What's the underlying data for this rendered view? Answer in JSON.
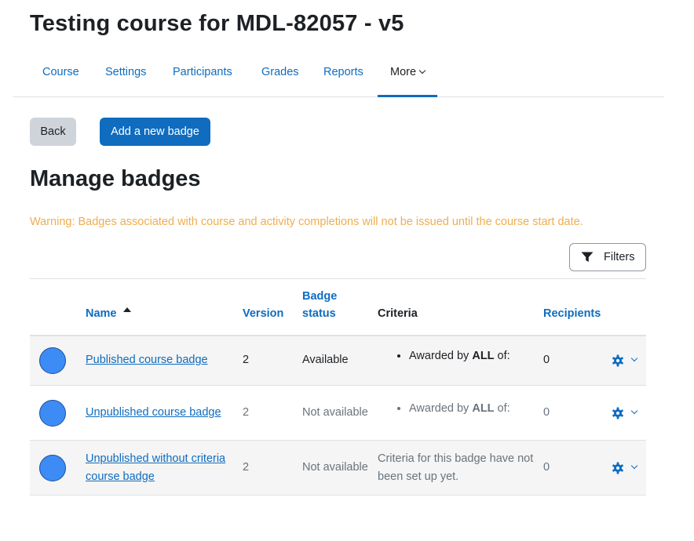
{
  "page": {
    "title": "Testing course for MDL-82057 - v5"
  },
  "nav": {
    "tabs": [
      {
        "label": "Course"
      },
      {
        "label": "Settings"
      },
      {
        "label": "Participants"
      },
      {
        "label": "Grades"
      },
      {
        "label": "Reports"
      },
      {
        "label": "More"
      }
    ]
  },
  "buttons": {
    "back": "Back",
    "add": "Add a new badge"
  },
  "section": {
    "title": "Manage badges",
    "warning": "Warning: Badges associated with course and activity completions will not be issued until the course start date."
  },
  "filters": {
    "label": "Filters",
    "icon": "filter-icon"
  },
  "table": {
    "headers": {
      "name": "Name",
      "version": "Version",
      "status_line1": "Badge",
      "status_line2": "status",
      "criteria": "Criteria",
      "recipients": "Recipients"
    },
    "rows": [
      {
        "name": "Published course badge",
        "version": "2",
        "status": "Available",
        "criteria_prefix": "Awarded by ",
        "criteria_strong": "ALL",
        "criteria_suffix": " of:",
        "recipients": "0"
      },
      {
        "name": "Unpublished course badge",
        "version": "2",
        "status": "Not available",
        "criteria_prefix": "Awarded by ",
        "criteria_strong": "ALL",
        "criteria_suffix": " of:",
        "recipients": "0"
      },
      {
        "name": "Unpublished without criteria course badge",
        "version": "2",
        "status": "Not available",
        "criteria_text": "Criteria for this badge have not been set up yet.",
        "recipients": "0"
      }
    ]
  },
  "colors": {
    "primary": "#0f6cbf",
    "warning": "#f0ad4e",
    "badge": "#3d8cf5"
  }
}
